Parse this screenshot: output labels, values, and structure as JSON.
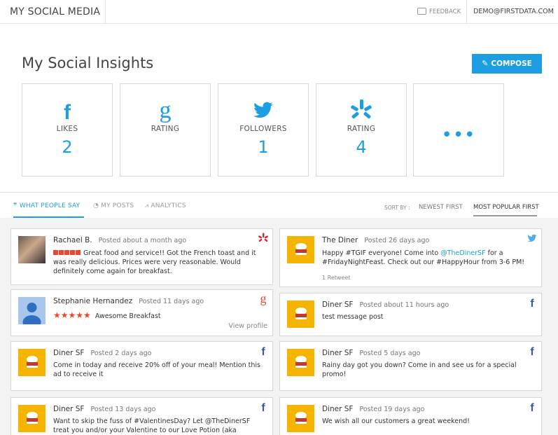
{
  "header": {
    "brand": "MY SOCIAL MEDIA",
    "feedback_label": "FEEDBACK",
    "user_email": "DEMO@FIRSTDATA.COM"
  },
  "insights": {
    "title": "My Social Insights",
    "compose_label": "COMPOSE",
    "cards": [
      {
        "icon": "facebook-icon",
        "label": "LIKES",
        "value": "2"
      },
      {
        "icon": "google-icon",
        "label": "RATING",
        "value": ""
      },
      {
        "icon": "twitter-icon",
        "label": "FOLLOWERS",
        "value": "1"
      },
      {
        "icon": "yelp-icon",
        "label": "RATING",
        "value": "4"
      },
      {
        "icon": "more-icon",
        "label": "",
        "value": "•••"
      }
    ]
  },
  "tabs": {
    "items": [
      "WHAT PEOPLE SAY",
      "MY POSTS",
      "ANALYTICS"
    ],
    "sort_by": "SORT BY :",
    "sort_options": [
      "NEWEST FIRST",
      "MOST POPULAR FIRST"
    ]
  },
  "posts_left": [
    {
      "author": "Rachael B.",
      "time": "Posted about a month ago",
      "text": "Great food and service!! Got the French toast and it was really delicious. Prices were very reasonable. Would definitely come again for breakfast.",
      "network": "yelp-icon",
      "rating": 5
    },
    {
      "author": "Stephanie Hernandez",
      "time": "Posted 11 days ago",
      "text": "Awesome Breakfast",
      "network": "google-icon",
      "rating": 5,
      "link": "View profile"
    },
    {
      "author": "Diner SF",
      "time": "Posted 2 days ago",
      "text": "Come in today and receive 20% off of your meal! Mention this ad to receive it",
      "network": "facebook-icon"
    },
    {
      "author": "Diner SF",
      "time": "Posted 13 days ago",
      "text": "Want to skip the fuss of #ValentinesDay? Let @TheDinerSF treat you and/or your Valentine to our Love Potion (aka",
      "network": "facebook-icon"
    }
  ],
  "posts_right": [
    {
      "author": "The Diner",
      "time": "Posted 26 days ago",
      "text_pre": "Happy #TGIF everyone! Come into ",
      "mention": "@TheDinerSF",
      "text_post": " for a #FridayNightFeast. Check out our #HappyHour from 3-6 PM!",
      "network": "twitter-icon",
      "retweet": "1 Retweet"
    },
    {
      "author": "Diner SF",
      "time": "Posted about 11 hours ago",
      "text": "test message post",
      "network": "facebook-icon"
    },
    {
      "author": "Diner SF",
      "time": "Posted 5 days ago",
      "text": "Rainy day got you down? Come in and see us for a special promo!",
      "network": "facebook-icon"
    },
    {
      "author": "Diner SF",
      "time": "Posted 19 days ago",
      "text": "We wish all our customers a great weekend!",
      "network": "facebook-icon"
    }
  ],
  "colors": {
    "accent": "#1d9ee3",
    "yelp": "#d32323",
    "google": "#dd4b39",
    "facebook": "#3b5998",
    "twitter": "#55acee",
    "diner": "#f5b400"
  }
}
